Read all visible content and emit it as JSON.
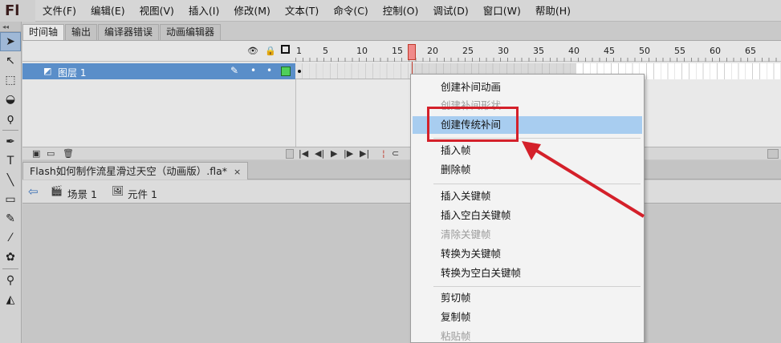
{
  "app": {
    "logo": "Fl"
  },
  "menu": [
    "文件(F)",
    "编辑(E)",
    "视图(V)",
    "插入(I)",
    "修改(M)",
    "文本(T)",
    "命令(C)",
    "控制(O)",
    "调试(D)",
    "窗口(W)",
    "帮助(H)"
  ],
  "panel_tabs": [
    "时间轴",
    "输出",
    "编译器错误",
    "动画编辑器"
  ],
  "timeline": {
    "ruler": [
      "1",
      "5",
      "10",
      "15",
      "20",
      "25",
      "30",
      "35",
      "40",
      "45",
      "50",
      "55",
      "60",
      "65"
    ],
    "layer_name": "图层 1",
    "current_frame": 20
  },
  "document": {
    "tab_title": "Flash如何制作流星滑过天空（动画版）.fla*",
    "close": "×"
  },
  "breadcrumb": {
    "scene": "场景 1",
    "symbol": "元件 1"
  },
  "context_menu": {
    "items": [
      {
        "label": "创建补间动画",
        "disabled": false
      },
      {
        "label": "创建补间形状",
        "disabled": true
      },
      {
        "label": "创建传统补间",
        "disabled": false,
        "highlighted": true
      },
      {
        "label": "插入帧",
        "disabled": false
      },
      {
        "label": "删除帧",
        "disabled": false
      },
      {
        "label": "插入关键帧",
        "disabled": false
      },
      {
        "label": "插入空白关键帧",
        "disabled": false
      },
      {
        "label": "清除关键帧",
        "disabled": true
      },
      {
        "label": "转换为关键帧",
        "disabled": false
      },
      {
        "label": "转换为空白关键帧",
        "disabled": false
      },
      {
        "label": "剪切帧",
        "disabled": false
      },
      {
        "label": "复制帧",
        "disabled": false
      },
      {
        "label": "粘贴帧",
        "disabled": true
      }
    ]
  },
  "colors": {
    "selection": "#5a8ec9",
    "annotation": "#d4202a",
    "layer_color": "#4fcf5a",
    "playhead": "#f08a8a"
  }
}
